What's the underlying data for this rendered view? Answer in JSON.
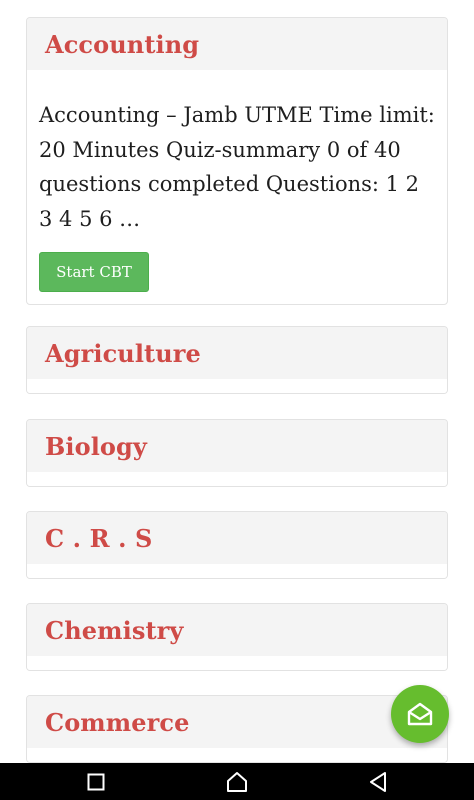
{
  "accordion": {
    "items": [
      {
        "title": "Accounting",
        "expanded": true,
        "description": "Accounting – Jamb UTME Time limit: 20 Minutes Quiz-summary 0 of 40 questions completed Questions: 1 2 3 4 5 6 …",
        "button_label": "Start CBT"
      },
      {
        "title": "Agriculture",
        "expanded": false
      },
      {
        "title": "Biology",
        "expanded": false
      },
      {
        "title": "C . R . S",
        "expanded": false
      },
      {
        "title": "Chemistry",
        "expanded": false
      },
      {
        "title": "Commerce",
        "expanded": false
      }
    ]
  },
  "fab": {
    "icon": "envelope-open-icon"
  },
  "system_nav": {
    "icons": [
      "recent-apps-icon",
      "home-icon",
      "back-icon"
    ]
  },
  "colors": {
    "title": "#cf4b47",
    "header_bg": "#f4f4f4",
    "button_bg": "#5cb85c",
    "fab_bg": "#66bd2e",
    "nav_bg": "#000000"
  }
}
